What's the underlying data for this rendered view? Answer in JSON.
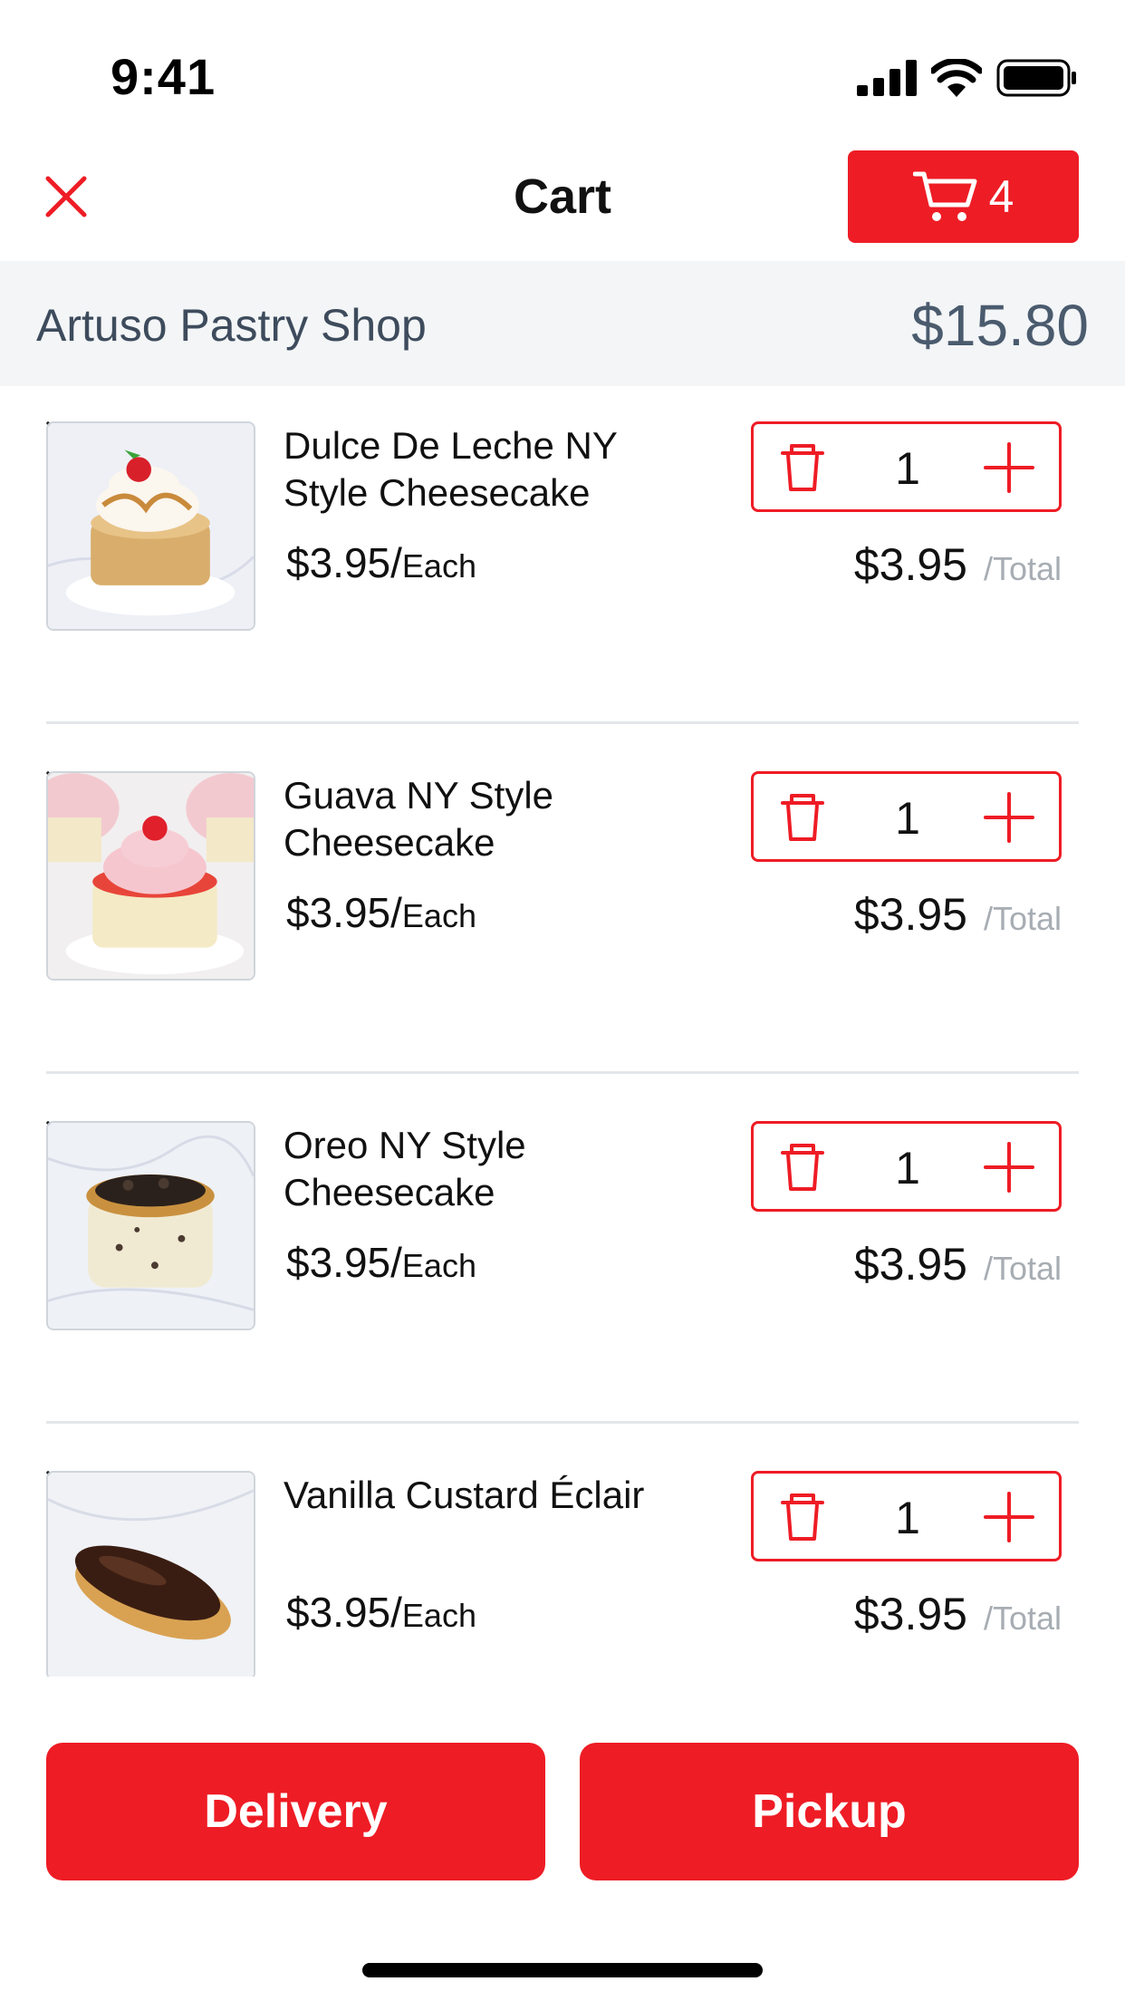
{
  "status_bar": {
    "time": "9:41"
  },
  "header": {
    "title": "Cart",
    "cart_count": "4"
  },
  "shop": {
    "name": "Artuso Pastry Shop",
    "total": "$15.80"
  },
  "items": [
    {
      "name": "Dulce De Leche NY Style Cheesecake",
      "price": "$3.95/",
      "unit": "Each",
      "quantity": "1",
      "line_total": "$3.95",
      "total_label": "/Total"
    },
    {
      "name": "Guava NY Style Cheesecake",
      "price": "$3.95/",
      "unit": "Each",
      "quantity": "1",
      "line_total": "$3.95",
      "total_label": "/Total"
    },
    {
      "name": "Oreo NY Style Cheesecake",
      "price": "$3.95/",
      "unit": "Each",
      "quantity": "1",
      "line_total": "$3.95",
      "total_label": "/Total"
    },
    {
      "name": "Vanilla Custard Éclair",
      "price": "$3.95/",
      "unit": "Each",
      "quantity": "1",
      "line_total": "$3.95",
      "total_label": "/Total"
    }
  ],
  "actions": {
    "delivery_label": "Delivery",
    "pickup_label": "Pickup"
  },
  "colors": {
    "accent": "#ee1c25",
    "shop_bar_bg": "#f3f5f7",
    "shop_text": "#3d4b5c",
    "muted": "#a7adb3"
  },
  "icons": [
    "close-icon",
    "cart-icon",
    "trash-icon",
    "plus-icon",
    "remove-item-icon",
    "signal-icon",
    "wifi-icon",
    "battery-icon"
  ]
}
